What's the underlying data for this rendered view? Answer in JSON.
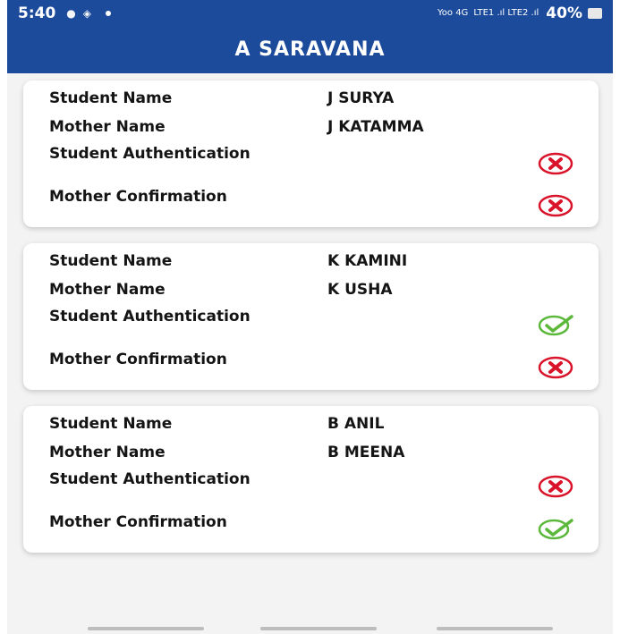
{
  "status_bar": {
    "time": "5:40",
    "network_left": "Yoo 4G",
    "network_right": "LTE1 .ıl LTE2 .ıl",
    "battery": "40%"
  },
  "app_bar": {
    "title": "A SARAVANA"
  },
  "labels": {
    "student_name": "Student Name",
    "mother_name": "Mother Name",
    "student_auth": "Student Authentication",
    "mother_conf": "Mother Confirmation"
  },
  "students": [
    {
      "student_name": "J SURYA",
      "mother_name": "J KATAMMA",
      "student_auth": "no",
      "mother_conf": "no"
    },
    {
      "student_name": "K KAMINI",
      "mother_name": "K USHA",
      "student_auth": "yes",
      "mother_conf": "no"
    },
    {
      "student_name": "B ANIL",
      "mother_name": "B MEENA",
      "student_auth": "no",
      "mother_conf": "yes"
    }
  ],
  "colors": {
    "app_bar": "#1d4b9b",
    "cross": "#d9142a",
    "check": "#5bb83b"
  }
}
